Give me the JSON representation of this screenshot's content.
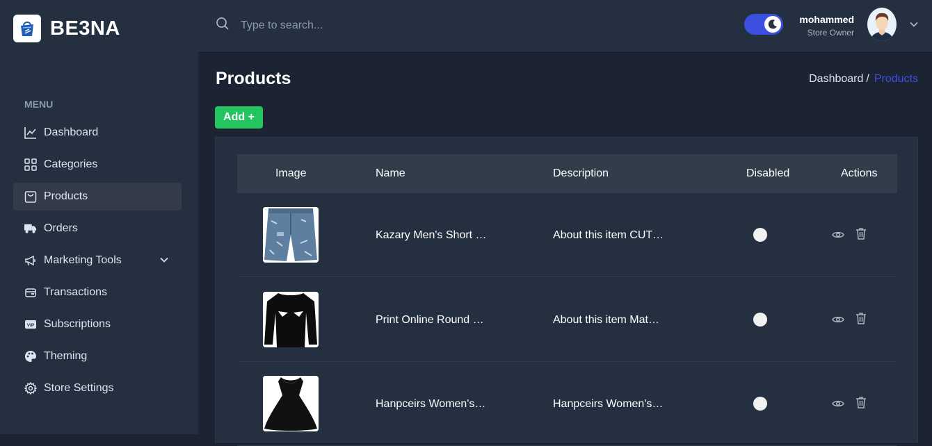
{
  "brand": {
    "name": "BE3NA",
    "logo_icon": "shopping-bag-logo-icon"
  },
  "sidebar": {
    "heading": "MENU",
    "items": [
      {
        "label": "Dashboard",
        "icon": "chart-line-icon"
      },
      {
        "label": "Categories",
        "icon": "grid-icon"
      },
      {
        "label": "Products",
        "icon": "bag-icon",
        "active": true
      },
      {
        "label": "Orders",
        "icon": "truck-icon"
      },
      {
        "label": "Marketing Tools",
        "icon": "megaphone-icon",
        "expandable": true
      },
      {
        "label": "Transactions",
        "icon": "wallet-icon"
      },
      {
        "label": "Subscriptions",
        "icon": "vip-icon"
      },
      {
        "label": "Theming",
        "icon": "palette-icon"
      },
      {
        "label": "Store Settings",
        "icon": "gear-icon"
      }
    ]
  },
  "header": {
    "search_placeholder": "Type to search...",
    "dark_mode": true,
    "user": {
      "name": "mohammed",
      "role": "Store Owner"
    }
  },
  "page": {
    "title": "Products",
    "breadcrumb": {
      "home": "Dashboard",
      "separator": "/",
      "current": "Products"
    },
    "add_button": "Add +"
  },
  "table": {
    "columns": [
      "Image",
      "Name",
      "Description",
      "Disabled",
      "Actions"
    ],
    "rows": [
      {
        "name": "Kazary Men's Short …",
        "description": "About this item CUT…",
        "disabled": false,
        "image": "denim-shorts"
      },
      {
        "name": "Print Online Round …",
        "description": "About this item Mat…",
        "disabled": false,
        "image": "black-long-sleeve-shirt"
      },
      {
        "name": "Hanpceirs Women's…",
        "description": "Hanpceirs Women's…",
        "disabled": false,
        "image": "black-dress"
      }
    ]
  },
  "colors": {
    "accent": "#3c50e0",
    "success": "#22c55e",
    "sidebar_bg": "#24303f",
    "page_bg": "#1c2434"
  }
}
